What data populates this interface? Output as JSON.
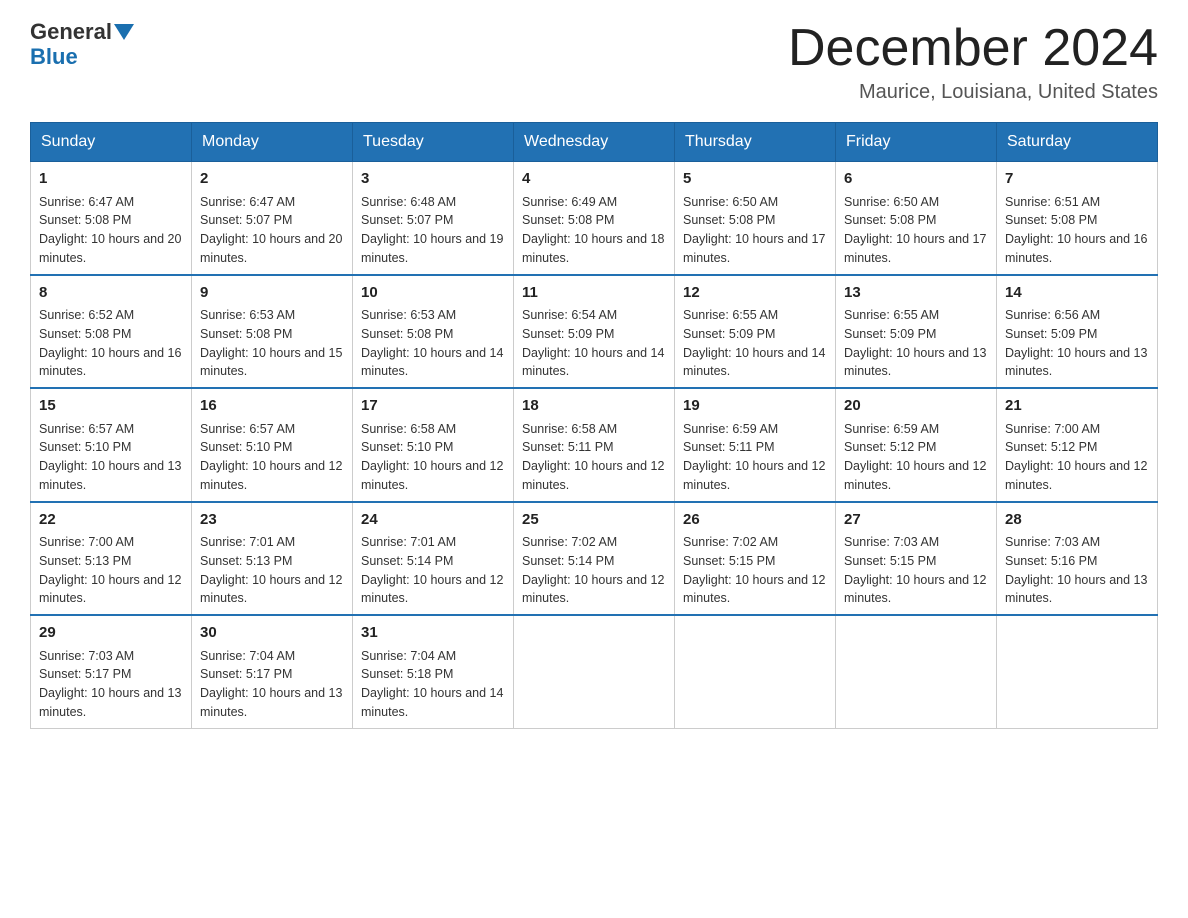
{
  "header": {
    "logo_general": "General",
    "logo_blue": "Blue",
    "month_title": "December 2024",
    "subtitle": "Maurice, Louisiana, United States"
  },
  "days_of_week": [
    "Sunday",
    "Monday",
    "Tuesday",
    "Wednesday",
    "Thursday",
    "Friday",
    "Saturday"
  ],
  "weeks": [
    [
      {
        "day": "1",
        "sunrise": "6:47 AM",
        "sunset": "5:08 PM",
        "daylight": "10 hours and 20 minutes."
      },
      {
        "day": "2",
        "sunrise": "6:47 AM",
        "sunset": "5:07 PM",
        "daylight": "10 hours and 20 minutes."
      },
      {
        "day": "3",
        "sunrise": "6:48 AM",
        "sunset": "5:07 PM",
        "daylight": "10 hours and 19 minutes."
      },
      {
        "day": "4",
        "sunrise": "6:49 AM",
        "sunset": "5:08 PM",
        "daylight": "10 hours and 18 minutes."
      },
      {
        "day": "5",
        "sunrise": "6:50 AM",
        "sunset": "5:08 PM",
        "daylight": "10 hours and 17 minutes."
      },
      {
        "day": "6",
        "sunrise": "6:50 AM",
        "sunset": "5:08 PM",
        "daylight": "10 hours and 17 minutes."
      },
      {
        "day": "7",
        "sunrise": "6:51 AM",
        "sunset": "5:08 PM",
        "daylight": "10 hours and 16 minutes."
      }
    ],
    [
      {
        "day": "8",
        "sunrise": "6:52 AM",
        "sunset": "5:08 PM",
        "daylight": "10 hours and 16 minutes."
      },
      {
        "day": "9",
        "sunrise": "6:53 AM",
        "sunset": "5:08 PM",
        "daylight": "10 hours and 15 minutes."
      },
      {
        "day": "10",
        "sunrise": "6:53 AM",
        "sunset": "5:08 PM",
        "daylight": "10 hours and 14 minutes."
      },
      {
        "day": "11",
        "sunrise": "6:54 AM",
        "sunset": "5:09 PM",
        "daylight": "10 hours and 14 minutes."
      },
      {
        "day": "12",
        "sunrise": "6:55 AM",
        "sunset": "5:09 PM",
        "daylight": "10 hours and 14 minutes."
      },
      {
        "day": "13",
        "sunrise": "6:55 AM",
        "sunset": "5:09 PM",
        "daylight": "10 hours and 13 minutes."
      },
      {
        "day": "14",
        "sunrise": "6:56 AM",
        "sunset": "5:09 PM",
        "daylight": "10 hours and 13 minutes."
      }
    ],
    [
      {
        "day": "15",
        "sunrise": "6:57 AM",
        "sunset": "5:10 PM",
        "daylight": "10 hours and 13 minutes."
      },
      {
        "day": "16",
        "sunrise": "6:57 AM",
        "sunset": "5:10 PM",
        "daylight": "10 hours and 12 minutes."
      },
      {
        "day": "17",
        "sunrise": "6:58 AM",
        "sunset": "5:10 PM",
        "daylight": "10 hours and 12 minutes."
      },
      {
        "day": "18",
        "sunrise": "6:58 AM",
        "sunset": "5:11 PM",
        "daylight": "10 hours and 12 minutes."
      },
      {
        "day": "19",
        "sunrise": "6:59 AM",
        "sunset": "5:11 PM",
        "daylight": "10 hours and 12 minutes."
      },
      {
        "day": "20",
        "sunrise": "6:59 AM",
        "sunset": "5:12 PM",
        "daylight": "10 hours and 12 minutes."
      },
      {
        "day": "21",
        "sunrise": "7:00 AM",
        "sunset": "5:12 PM",
        "daylight": "10 hours and 12 minutes."
      }
    ],
    [
      {
        "day": "22",
        "sunrise": "7:00 AM",
        "sunset": "5:13 PM",
        "daylight": "10 hours and 12 minutes."
      },
      {
        "day": "23",
        "sunrise": "7:01 AM",
        "sunset": "5:13 PM",
        "daylight": "10 hours and 12 minutes."
      },
      {
        "day": "24",
        "sunrise": "7:01 AM",
        "sunset": "5:14 PM",
        "daylight": "10 hours and 12 minutes."
      },
      {
        "day": "25",
        "sunrise": "7:02 AM",
        "sunset": "5:14 PM",
        "daylight": "10 hours and 12 minutes."
      },
      {
        "day": "26",
        "sunrise": "7:02 AM",
        "sunset": "5:15 PM",
        "daylight": "10 hours and 12 minutes."
      },
      {
        "day": "27",
        "sunrise": "7:03 AM",
        "sunset": "5:15 PM",
        "daylight": "10 hours and 12 minutes."
      },
      {
        "day": "28",
        "sunrise": "7:03 AM",
        "sunset": "5:16 PM",
        "daylight": "10 hours and 13 minutes."
      }
    ],
    [
      {
        "day": "29",
        "sunrise": "7:03 AM",
        "sunset": "5:17 PM",
        "daylight": "10 hours and 13 minutes."
      },
      {
        "day": "30",
        "sunrise": "7:04 AM",
        "sunset": "5:17 PM",
        "daylight": "10 hours and 13 minutes."
      },
      {
        "day": "31",
        "sunrise": "7:04 AM",
        "sunset": "5:18 PM",
        "daylight": "10 hours and 14 minutes."
      },
      null,
      null,
      null,
      null
    ]
  ],
  "labels": {
    "sunrise": "Sunrise:",
    "sunset": "Sunset:",
    "daylight": "Daylight:"
  }
}
